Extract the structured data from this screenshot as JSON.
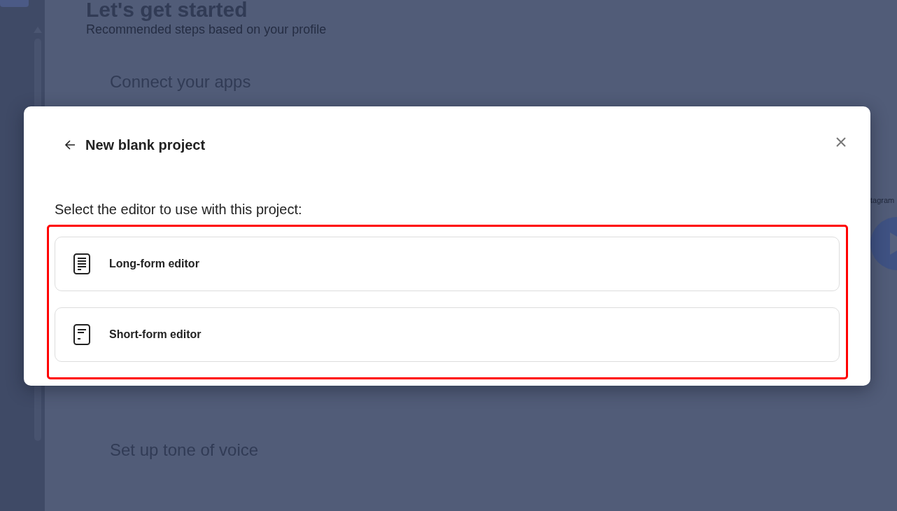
{
  "background": {
    "heading": "Let's get started",
    "subtitle": "Recommended steps based on your profile",
    "sections": [
      {
        "title": "Connect your apps"
      },
      {
        "title": "Set up tone of voice"
      }
    ],
    "side_card": {
      "label": "tagram"
    }
  },
  "dialog": {
    "title": "New blank project",
    "prompt": "Select the editor to use with this project:",
    "options": [
      {
        "kind": "long",
        "label": "Long-form editor"
      },
      {
        "kind": "short",
        "label": "Short-form editor"
      }
    ]
  }
}
